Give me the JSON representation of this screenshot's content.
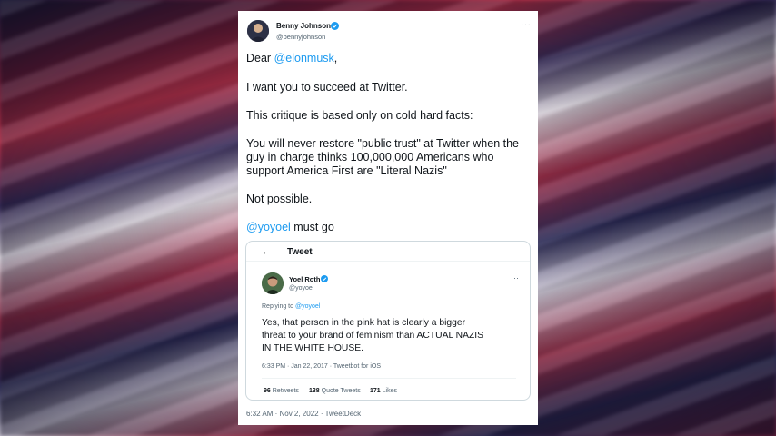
{
  "tweet": {
    "author_name": "Benny Johnson",
    "author_handle": "@bennyjohnson",
    "more": "···",
    "lines": {
      "greeting_prefix": "Dear ",
      "greeting_mention": "@elonmusk",
      "greeting_suffix": ",",
      "line2": "I want you to succeed at Twitter.",
      "line3": "This critique is based only on cold hard facts:",
      "line4a": "You will never restore \"public trust\" at Twitter when the",
      "line4b": "guy in charge thinks 100,000,000 Americans who",
      "line4c": "support America First are \"Literal Nazis\"",
      "line5": "Not possible.",
      "line6_mention": "@yoyoel",
      "line6_suffix": " must go"
    },
    "footer": "6:32 AM · Nov 2, 2022 · TweetDeck"
  },
  "quoted": {
    "back_icon": "←",
    "header_title": "Tweet",
    "author_name": "Yoel Roth",
    "author_handle": "@yoyoel",
    "more": "···",
    "reply_prefix": "Replying to ",
    "reply_mention": "@yoyoel",
    "text_lines": [
      "Yes, that person in the pink hat is clearly a bigger",
      "threat to your brand of feminism than ACTUAL NAZIS",
      "IN THE WHITE HOUSE."
    ],
    "meta": "6:33 PM · Jan 22, 2017 · Tweetbot for iOS",
    "stats": {
      "retweets_count": "96",
      "retweets_label": " Retweets",
      "quotes_count": "138",
      "quotes_label": " Quote Tweets",
      "likes_count": "171",
      "likes_label": " Likes"
    }
  },
  "colors": {
    "link": "#1d9bf0",
    "verified": "#1d9bf0",
    "text": "#0f1419",
    "muted": "#536471"
  }
}
